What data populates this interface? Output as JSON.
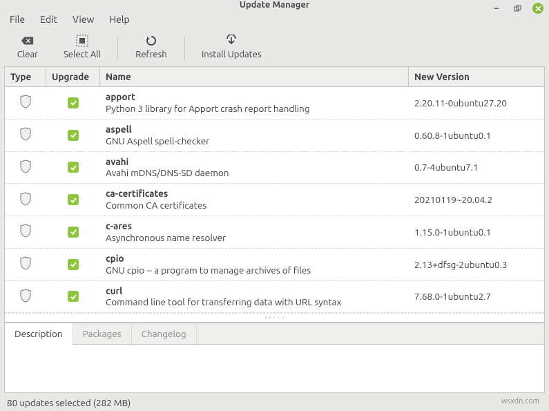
{
  "window": {
    "title": "Update Manager"
  },
  "titlebar_controls": {
    "minimize": "−",
    "maximize": "▫",
    "close": "×"
  },
  "menubar": [
    {
      "id": "file",
      "label": "File"
    },
    {
      "id": "edit",
      "label": "Edit"
    },
    {
      "id": "view",
      "label": "View"
    },
    {
      "id": "help",
      "label": "Help"
    }
  ],
  "toolbar": {
    "clear": "Clear",
    "select_all": "Select All",
    "refresh": "Refresh",
    "install": "Install Updates"
  },
  "columns": {
    "type": "Type",
    "upgrade": "Upgrade",
    "name": "Name",
    "version": "New Version"
  },
  "packages": [
    {
      "name": "apport",
      "desc": "Python 3 library for Apport crash report handling",
      "version": "2.20.11-0ubuntu27.20"
    },
    {
      "name": "aspell",
      "desc": "GNU Aspell spell-checker",
      "version": "0.60.8-1ubuntu0.1"
    },
    {
      "name": "avahi",
      "desc": "Avahi mDNS/DNS-SD daemon",
      "version": "0.7-4ubuntu7.1"
    },
    {
      "name": "ca-certificates",
      "desc": "Common CA certificates",
      "version": "20210119~20.04.2"
    },
    {
      "name": "c-ares",
      "desc": "Asynchronous name resolver",
      "version": "1.15.0-1ubuntu0.1"
    },
    {
      "name": "cpio",
      "desc": "GNU cpio -- a program to manage archives of files",
      "version": "2.13+dfsg-2ubuntu0.3"
    },
    {
      "name": "curl",
      "desc": "Command line tool for transferring data with URL syntax",
      "version": "7.68.0-1ubuntu2.7"
    }
  ],
  "tabs": {
    "description": "Description",
    "packages": "Packages",
    "changelog": "Changelog"
  },
  "statusbar": {
    "text": "80 updates selected (282 MB)"
  },
  "attribution": "wsxdn.com"
}
